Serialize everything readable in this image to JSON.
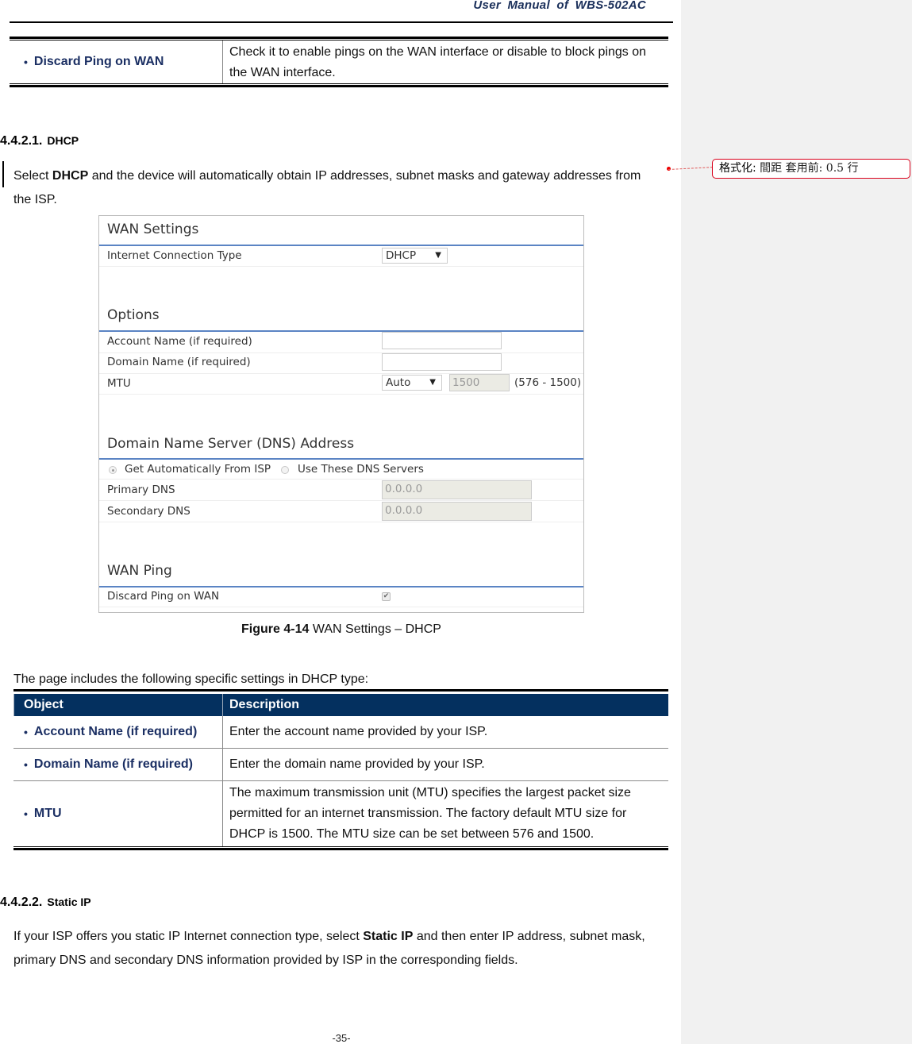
{
  "header": {
    "title": "User  Manual  of  WBS-502AC"
  },
  "top_table": {
    "rows": [
      {
        "object": "Discard Ping on WAN",
        "description_line1": "Check it to enable pings on the WAN interface or disable to block pings on",
        "description_line2": "the WAN interface."
      }
    ]
  },
  "section_dhcp": {
    "number": "4.4.2.1.",
    "title": "DHCP",
    "para_prefix": "Select ",
    "para_bold": "DHCP",
    "para_suffix_line1": " and the device will automatically obtain IP addresses, subnet masks and gateway addresses from",
    "para_line2": "the ISP."
  },
  "figure": {
    "wan_settings": {
      "title": "WAN Settings",
      "connection_type_label": "Internet Connection Type",
      "connection_type_value": "DHCP"
    },
    "options": {
      "title": "Options",
      "account_name_label": "Account Name (if required)",
      "account_name_value": "",
      "domain_name_label": "Domain Name (if required)",
      "domain_name_value": "",
      "mtu_label": "MTU",
      "mtu_mode": "Auto",
      "mtu_value": "1500",
      "mtu_range": "(576 - 1500)"
    },
    "dns": {
      "title": "Domain Name Server (DNS) Address",
      "radio_auto_label": "Get Automatically From ISP",
      "radio_manual_label": "Use These DNS Servers",
      "selected": "auto",
      "primary_label": "Primary DNS",
      "primary_value": "0.0.0.0",
      "secondary_label": "Secondary DNS",
      "secondary_value": "0.0.0.0"
    },
    "wan_ping": {
      "title": "WAN Ping",
      "discard_label": "Discard Ping on WAN",
      "discard_checked": true
    },
    "caption_bold": "Figure 4-14",
    "caption_text": " WAN Settings – DHCP"
  },
  "intro_text": "The page includes the following specific settings in DHCP type:",
  "dhcp_table": {
    "headers": {
      "object": "Object",
      "description": "Description"
    },
    "rows": [
      {
        "object": "Account Name (if required)",
        "description": [
          "Enter the account name provided by your ISP."
        ]
      },
      {
        "object": "Domain Name (if required)",
        "description": [
          "Enter the domain name provided by your ISP."
        ]
      },
      {
        "object": "MTU",
        "description": [
          "The maximum transmission unit (MTU) specifies the largest packet size",
          "permitted for an internet transmission. The factory default MTU size for",
          "DHCP is 1500. The MTU size can be set between 576 and 1500."
        ]
      }
    ]
  },
  "section_static": {
    "number": "4.4.2.2.",
    "title": "Static IP",
    "para_prefix": "If your ISP offers you static IP Internet connection type, select ",
    "para_bold": "Static IP",
    "para_suffix_line1": " and then enter IP address, subnet mask,",
    "para_line2": "primary DNS and secondary DNS information provided by ISP in the corresponding fields."
  },
  "comment": {
    "label": "格式化:",
    "text": " 間距 套用前:  0.5 行"
  },
  "footer": {
    "page_number": "-35-"
  }
}
